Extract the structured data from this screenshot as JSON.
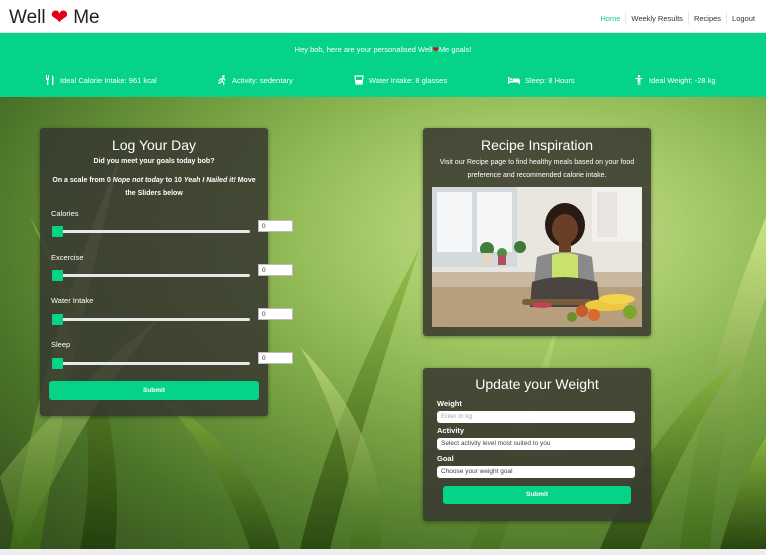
{
  "nav": {
    "brand_left": "Well",
    "brand_right": "Me",
    "links": [
      "Home",
      "Weekly Results",
      "Recipes",
      "Logout"
    ]
  },
  "banner": {
    "greeting_prefix": "Hey bob, here are your personalised Well",
    "greeting_suffix": "Me goals!",
    "stats": [
      {
        "icon": "fork-knife-icon",
        "text": "Ideal Calorie Intake: 961 kcal"
      },
      {
        "icon": "running-icon",
        "text": "Activity: sedentary"
      },
      {
        "icon": "water-glass-icon",
        "text": "Water Intake: 8 glasses"
      },
      {
        "icon": "bed-icon",
        "text": "Sleep: 8 Hours"
      },
      {
        "icon": "person-icon",
        "text": "Ideal Weight: -28 kg"
      }
    ]
  },
  "log": {
    "title": "Log Your Day",
    "question": "Did you meet your goals today bob?",
    "scale_text_1": "On a scale from ",
    "scale_low": "0",
    "scale_low_label": "Nope not today",
    "scale_to": " to ",
    "scale_high": "10",
    "scale_high_label": "Yeah I Nailed it!",
    "scale_text_2": " Move the Sliders below",
    "sliders": [
      {
        "label": "Calories",
        "value": "0"
      },
      {
        "label": "Excercise",
        "value": "0"
      },
      {
        "label": "Water Intake",
        "value": "0"
      },
      {
        "label": "Sleep",
        "value": "0"
      }
    ],
    "submit": "Submit"
  },
  "recipe": {
    "title": "Recipe Inspiration",
    "text": "Visit our Recipe page to find healthy meals based on your food preference and recommended calorie intake."
  },
  "weight": {
    "title": "Update your Weight",
    "weight_label": "Weight",
    "weight_placeholder": "Enter in kg",
    "activity_label": "Activity",
    "activity_value": "Select activity level most suited to you",
    "goal_label": "Goal",
    "goal_value": "Choose your weight goal",
    "submit": "Submit"
  },
  "colors": {
    "accent": "#05d388",
    "heart": "#e0001a"
  }
}
